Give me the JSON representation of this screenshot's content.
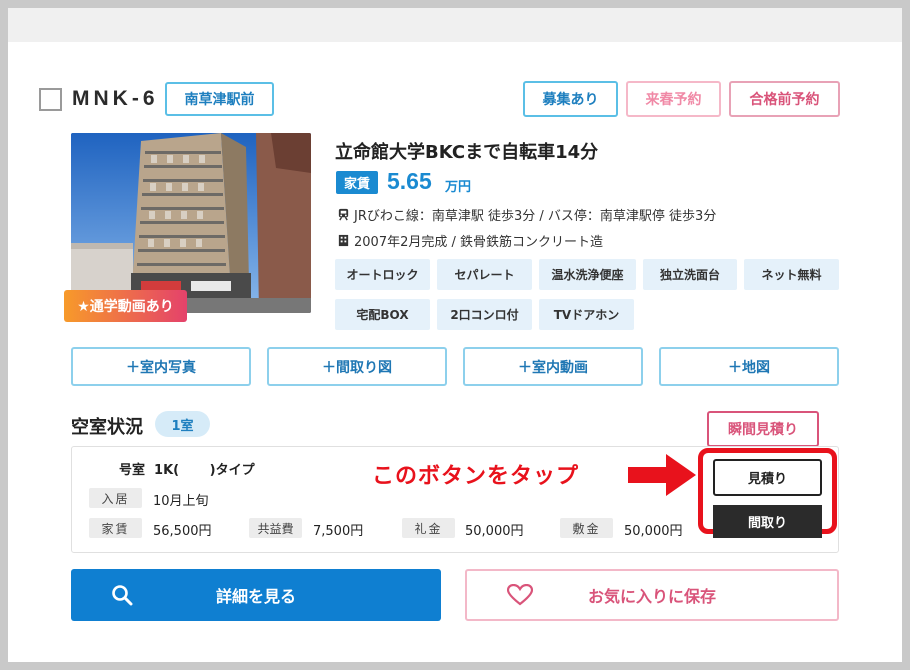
{
  "property": {
    "code": "MNK-6",
    "station_tag": "南草津駅前",
    "status_tags": [
      "募集あり",
      "来春予約",
      "合格前予約"
    ],
    "title": "立命館大学BKCまで自転車14分",
    "rent_label": "家賃",
    "rent_value": "5.65",
    "rent_unit": "万円",
    "access": "JRびわこ線：南草津駅 徒歩3分 / バス停：南草津駅停 徒歩3分",
    "built": "2007年2月完成 / 鉄骨鉄筋コンクリート造",
    "video_badge": "★通学動画あり",
    "features": [
      "オートロック",
      "セパレート",
      "温水洗浄便座",
      "独立洗面台",
      "ネット無料",
      "宅配BOX",
      "2口コンロ付",
      "TVドアホン"
    ]
  },
  "actions": {
    "photos": "＋室内写真",
    "floorplan": "＋間取り図",
    "video": "＋室内動画",
    "map": "＋地図"
  },
  "vacancy": {
    "title": "空室状況",
    "count": "1室",
    "instant_quote": "瞬間見積り",
    "room_type": "号室  1K(　　 )タイプ",
    "move_in_label": "入居",
    "move_in_value": "10月上旬",
    "rent_label": "家賃",
    "rent_value": "56,500円",
    "common_label": "共益費",
    "common_value": "7,500円",
    "key_money_label": "礼金",
    "key_money_value": "50,000円",
    "deposit_label": "敷金",
    "deposit_value": "50,000円",
    "quote_button": "見積り",
    "floorplan_button": "間取り"
  },
  "callout": {
    "text": "このボタンをタップ",
    "color": "#e8121c"
  },
  "footer": {
    "detail_button": "詳細を見る",
    "favorite_button": "お気に入りに保存"
  },
  "colors": {
    "accent_blue": "#0f7fd1",
    "accent_pink": "#d9547a",
    "highlight_red": "#e8121c"
  }
}
